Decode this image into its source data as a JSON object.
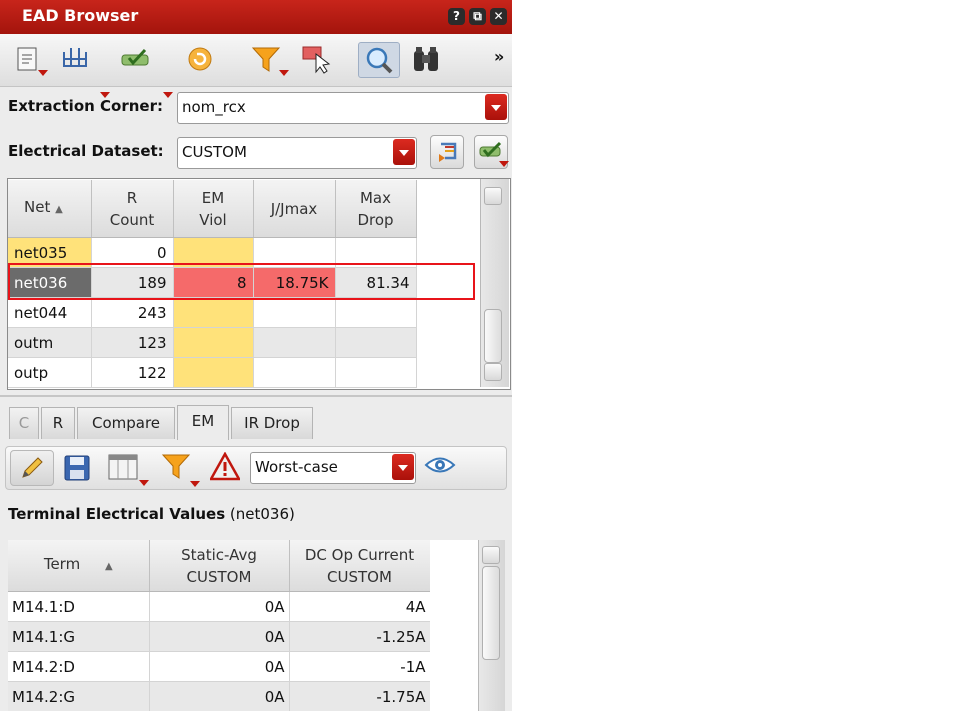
{
  "window": {
    "title": "EAD Browser",
    "buttons": [
      "?",
      "⧉",
      "✕"
    ]
  },
  "toolbar": {
    "overflow": "»"
  },
  "corner": {
    "label": "Extraction Corner:",
    "value": "nom_rcx"
  },
  "dataset": {
    "label": "Electrical Dataset:",
    "value": "CUSTOM"
  },
  "nets_table": {
    "headers": [
      {
        "line1": "Net",
        "line2": ""
      },
      {
        "line1": "R",
        "line2": "Count"
      },
      {
        "line1": "EM",
        "line2": "Viol"
      },
      {
        "line1": "J/Jmax",
        "line2": ""
      },
      {
        "line1": "Max",
        "line2": "Drop"
      }
    ],
    "rows": [
      {
        "net": "net035",
        "rcount": "0",
        "emviol": "",
        "jjmax": "",
        "maxdrop": ""
      },
      {
        "net": "net036",
        "rcount": "189",
        "emviol": "8",
        "jjmax": "18.75K",
        "maxdrop": "81.34"
      },
      {
        "net": "net044",
        "rcount": "243",
        "emviol": "",
        "jjmax": "",
        "maxdrop": ""
      },
      {
        "net": "outm",
        "rcount": "123",
        "emviol": "",
        "jjmax": "",
        "maxdrop": ""
      },
      {
        "net": "outp",
        "rcount": "122",
        "emviol": "",
        "jjmax": "",
        "maxdrop": ""
      }
    ]
  },
  "tabs": [
    "C",
    "R",
    "Compare",
    "EM",
    "IR Drop"
  ],
  "active_tab": "EM",
  "em_toolbar": {
    "mode": "Worst-case"
  },
  "section": {
    "title": "Terminal Electrical Values",
    "net": "(net036)"
  },
  "term_table": {
    "headers": [
      {
        "line1": "Term",
        "line2": ""
      },
      {
        "line1": "Static-Avg",
        "line2": "CUSTOM"
      },
      {
        "line1": "DC Op Current",
        "line2": "CUSTOM"
      }
    ],
    "rows": [
      {
        "term": "M14.1:D",
        "static": "0A",
        "dc": "4A"
      },
      {
        "term": "M14.1:G",
        "static": "0A",
        "dc": "-1.25A"
      },
      {
        "term": "M14.2:D",
        "static": "0A",
        "dc": "-1A"
      },
      {
        "term": "M14.2:G",
        "static": "0A",
        "dc": "-1.75A"
      }
    ]
  },
  "colors": {
    "titlebar": "#b81b12",
    "highlight_border": "#e8141a",
    "em_yellow": "#ffe27a",
    "em_red": "#f56a6a",
    "selected_net": "#6b6b6b"
  }
}
